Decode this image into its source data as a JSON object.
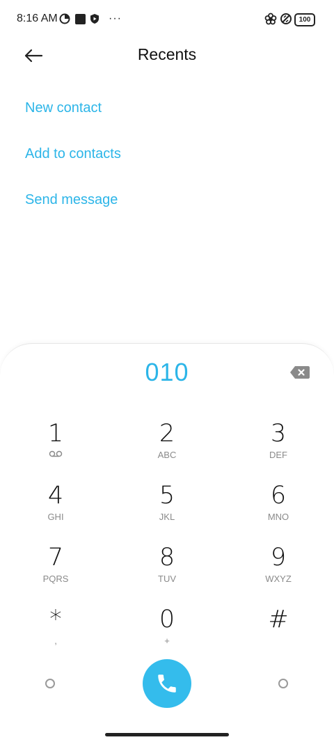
{
  "status_bar": {
    "time": "8:16 AM",
    "more": "···",
    "battery": "100"
  },
  "header": {
    "title": "Recents"
  },
  "actions": {
    "new_contact": "New contact",
    "add_to_contacts": "Add to contacts",
    "send_message": "Send message"
  },
  "dialpad": {
    "number": "010",
    "keys": [
      {
        "digit": "1",
        "sub": ""
      },
      {
        "digit": "2",
        "sub": "ABC"
      },
      {
        "digit": "3",
        "sub": "DEF"
      },
      {
        "digit": "4",
        "sub": "GHI"
      },
      {
        "digit": "5",
        "sub": "JKL"
      },
      {
        "digit": "6",
        "sub": "MNO"
      },
      {
        "digit": "7",
        "sub": "PQRS"
      },
      {
        "digit": "8",
        "sub": "TUV"
      },
      {
        "digit": "9",
        "sub": "WXYZ"
      },
      {
        "digit": "*",
        "sub": ","
      },
      {
        "digit": "0",
        "sub": "+"
      },
      {
        "digit": "#",
        "sub": ""
      }
    ]
  },
  "colors": {
    "accent": "#2cb5e8",
    "call_button": "#34bcec"
  }
}
